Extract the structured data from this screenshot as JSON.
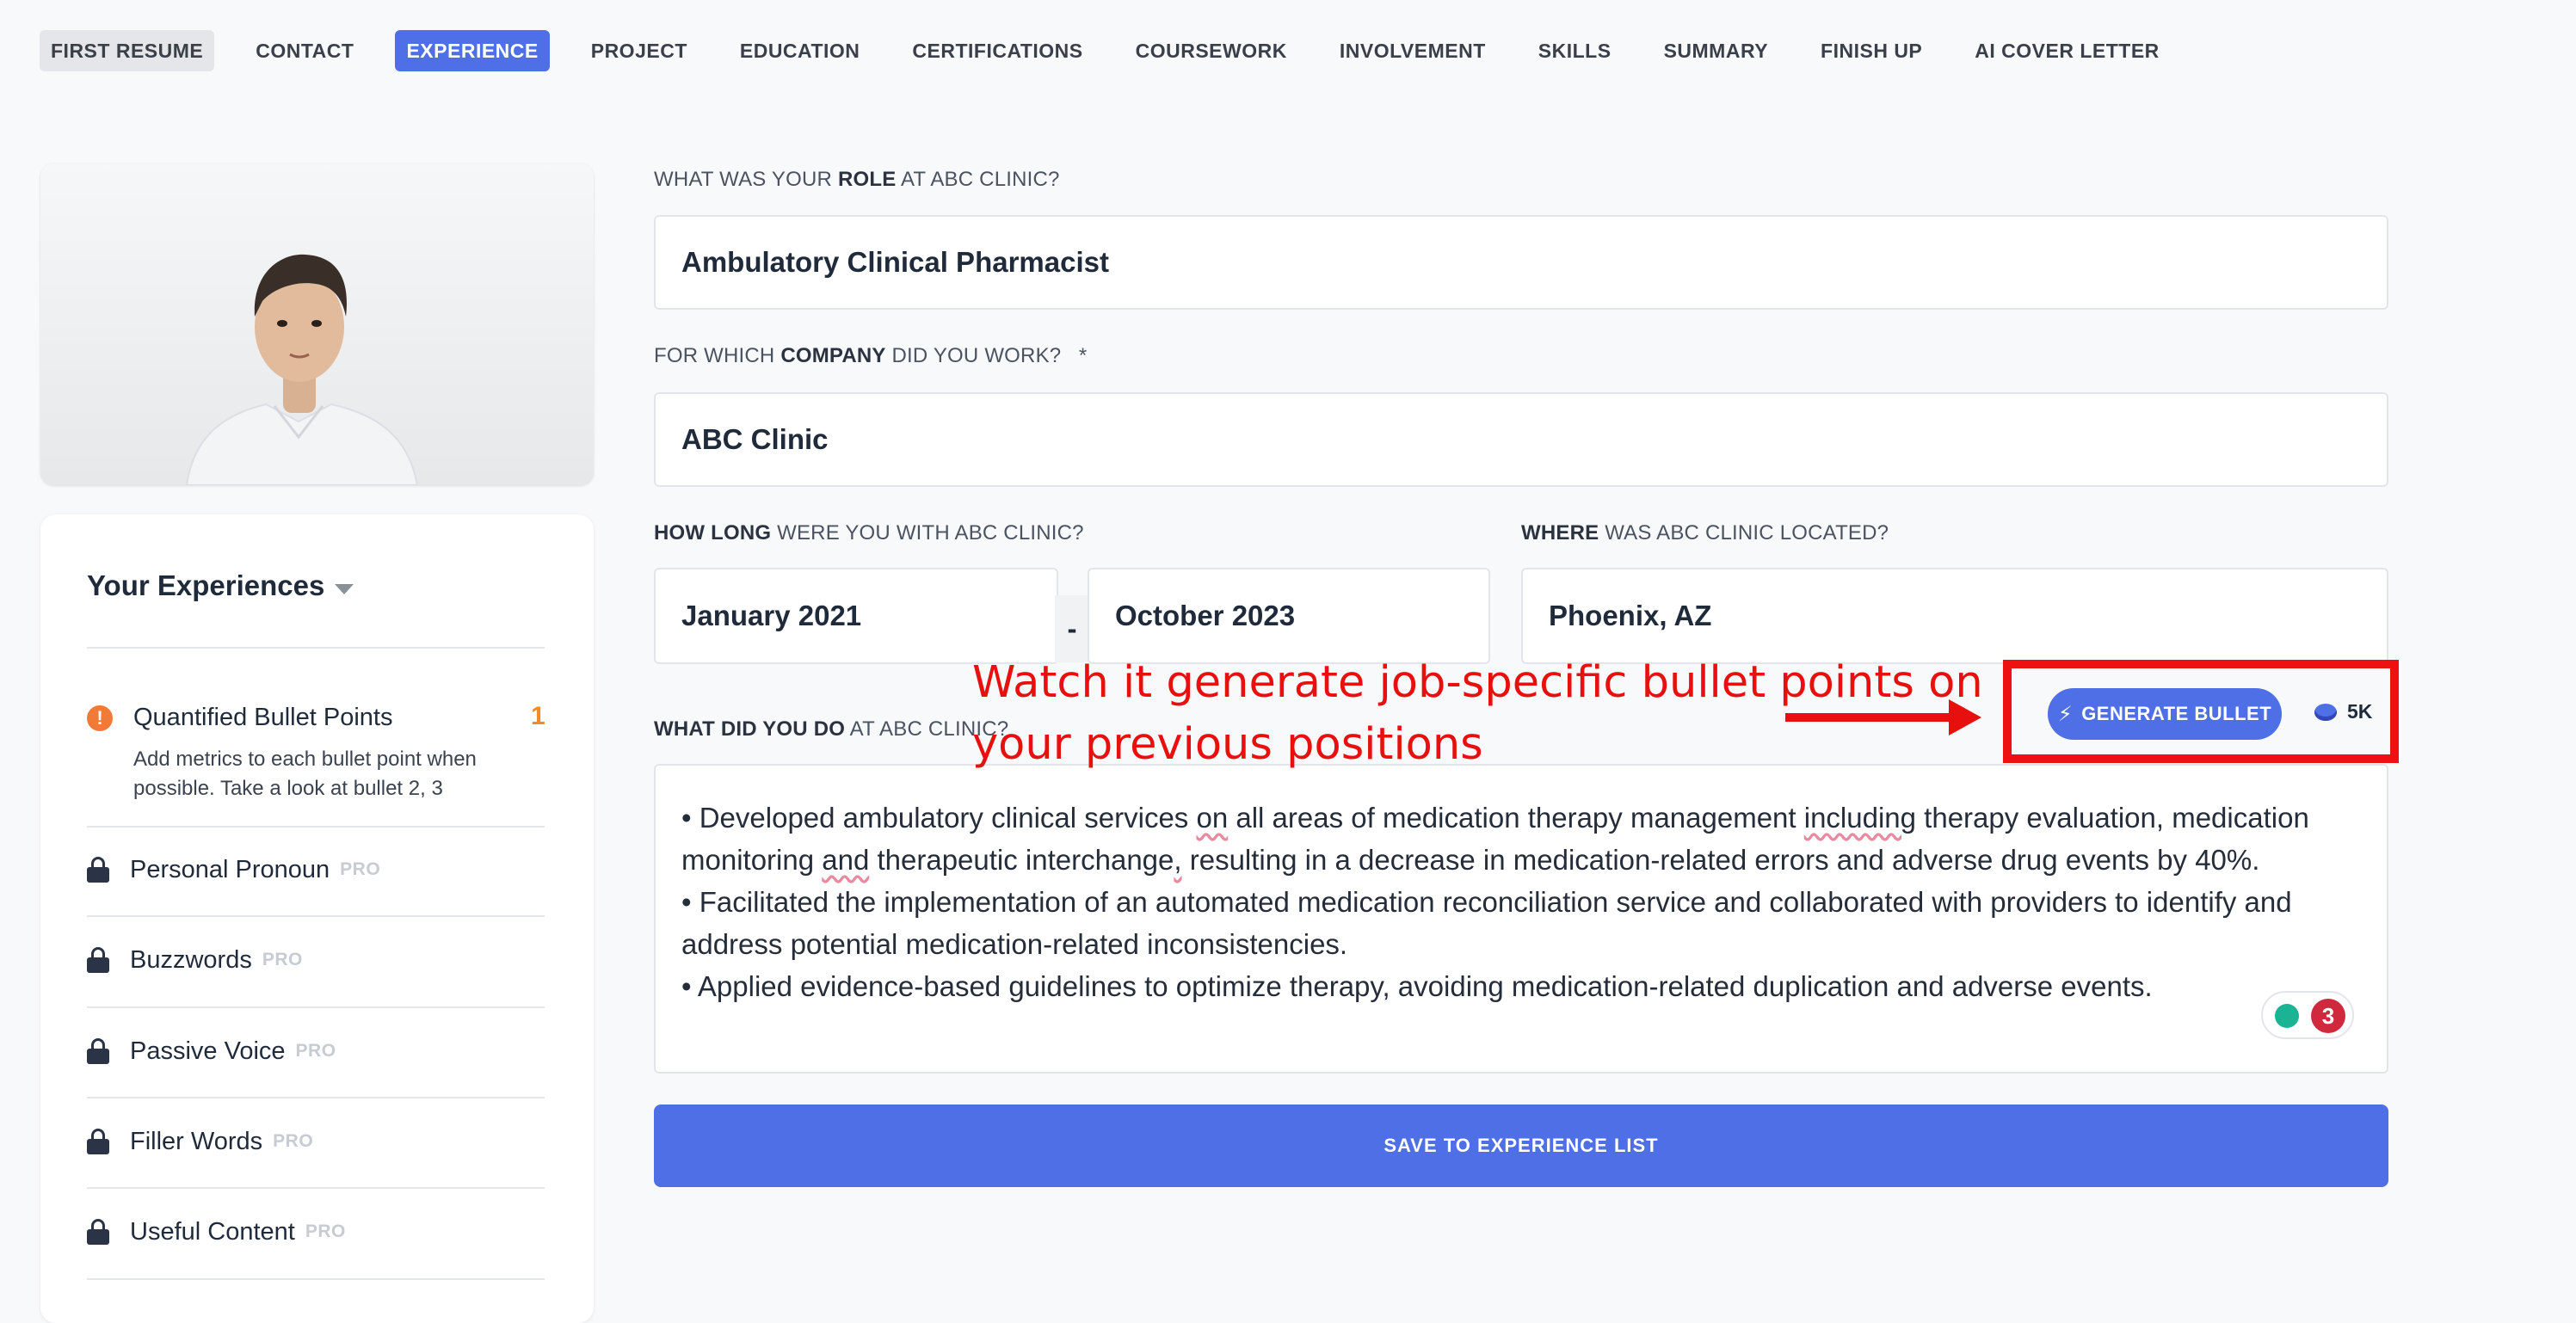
{
  "nav": {
    "items": [
      "FIRST RESUME",
      "CONTACT",
      "EXPERIENCE",
      "PROJECT",
      "EDUCATION",
      "CERTIFICATIONS",
      "COURSEWORK",
      "INVOLVEMENT",
      "SKILLS",
      "SUMMARY",
      "FINISH UP",
      "AI COVER LETTER"
    ],
    "active": "EXPERIENCE"
  },
  "sidebar": {
    "title": "Your Experiences",
    "quantified": {
      "title": "Quantified Bullet Points",
      "count": "1",
      "description": "Add metrics to each bullet point when possible. Take a look at bullet 2, 3"
    },
    "locked_items": [
      {
        "label": "Personal Pronoun",
        "badge": "PRO"
      },
      {
        "label": "Buzzwords",
        "badge": "PRO"
      },
      {
        "label": "Passive Voice",
        "badge": "PRO"
      },
      {
        "label": "Filler Words",
        "badge": "PRO"
      },
      {
        "label": "Useful Content",
        "badge": "PRO"
      }
    ]
  },
  "form": {
    "role_label": {
      "pre": "WHAT WAS YOUR ",
      "bold": "ROLE",
      "post": " AT ABC CLINIC?"
    },
    "role_value": "Ambulatory Clinical Pharmacist",
    "company_label": {
      "pre": "FOR WHICH ",
      "bold": "COMPANY",
      "post": " DID YOU WORK?   *"
    },
    "company_value": "ABC Clinic",
    "duration_label": {
      "bold": "HOW LONG",
      "post": " WERE YOU WITH ABC CLINIC?"
    },
    "start_date": "January 2021",
    "date_separator": "-",
    "end_date": "October 2023",
    "location_label": {
      "bold": "WHERE",
      "post": " WAS ABC CLINIC LOCATED?"
    },
    "location_value": "Phoenix, AZ",
    "duties_label": {
      "bold": "WHAT DID YOU DO",
      "post": " AT ABC CLINIC?"
    },
    "generate_button": "GENERATE BULLET",
    "credits": "5K",
    "bullets": {
      "b1a": "• Developed ambulatory clinical services ",
      "b1w1": "on",
      "b1b": " all areas of medication therapy management ",
      "b1w2": "including",
      "b1c": " therapy evaluation, medication monitoring ",
      "b1w3": "and",
      "b1d": " therapeutic interchange",
      "b1w4": ",",
      "b1e": " resulting in a decrease in medication-related errors and adverse drug events by 40%.",
      "b2": "• Facilitated the implementation of an automated medication reconciliation service and collaborated with providers to identify and address potential medication-related inconsistencies.",
      "b3": "• Applied evidence-based guidelines to optimize therapy, avoiding medication-related duplication and adverse events."
    },
    "assistant_count": "3",
    "save_button": "SAVE TO EXPERIENCE LIST"
  },
  "annotation": {
    "text": "Watch it generate job-specific bullet points on your previous positions"
  },
  "colors": {
    "accent": "#4f6fe6",
    "annotation": "#e8100f",
    "warning": "#f07a36",
    "badge_red": "#d0283c"
  }
}
